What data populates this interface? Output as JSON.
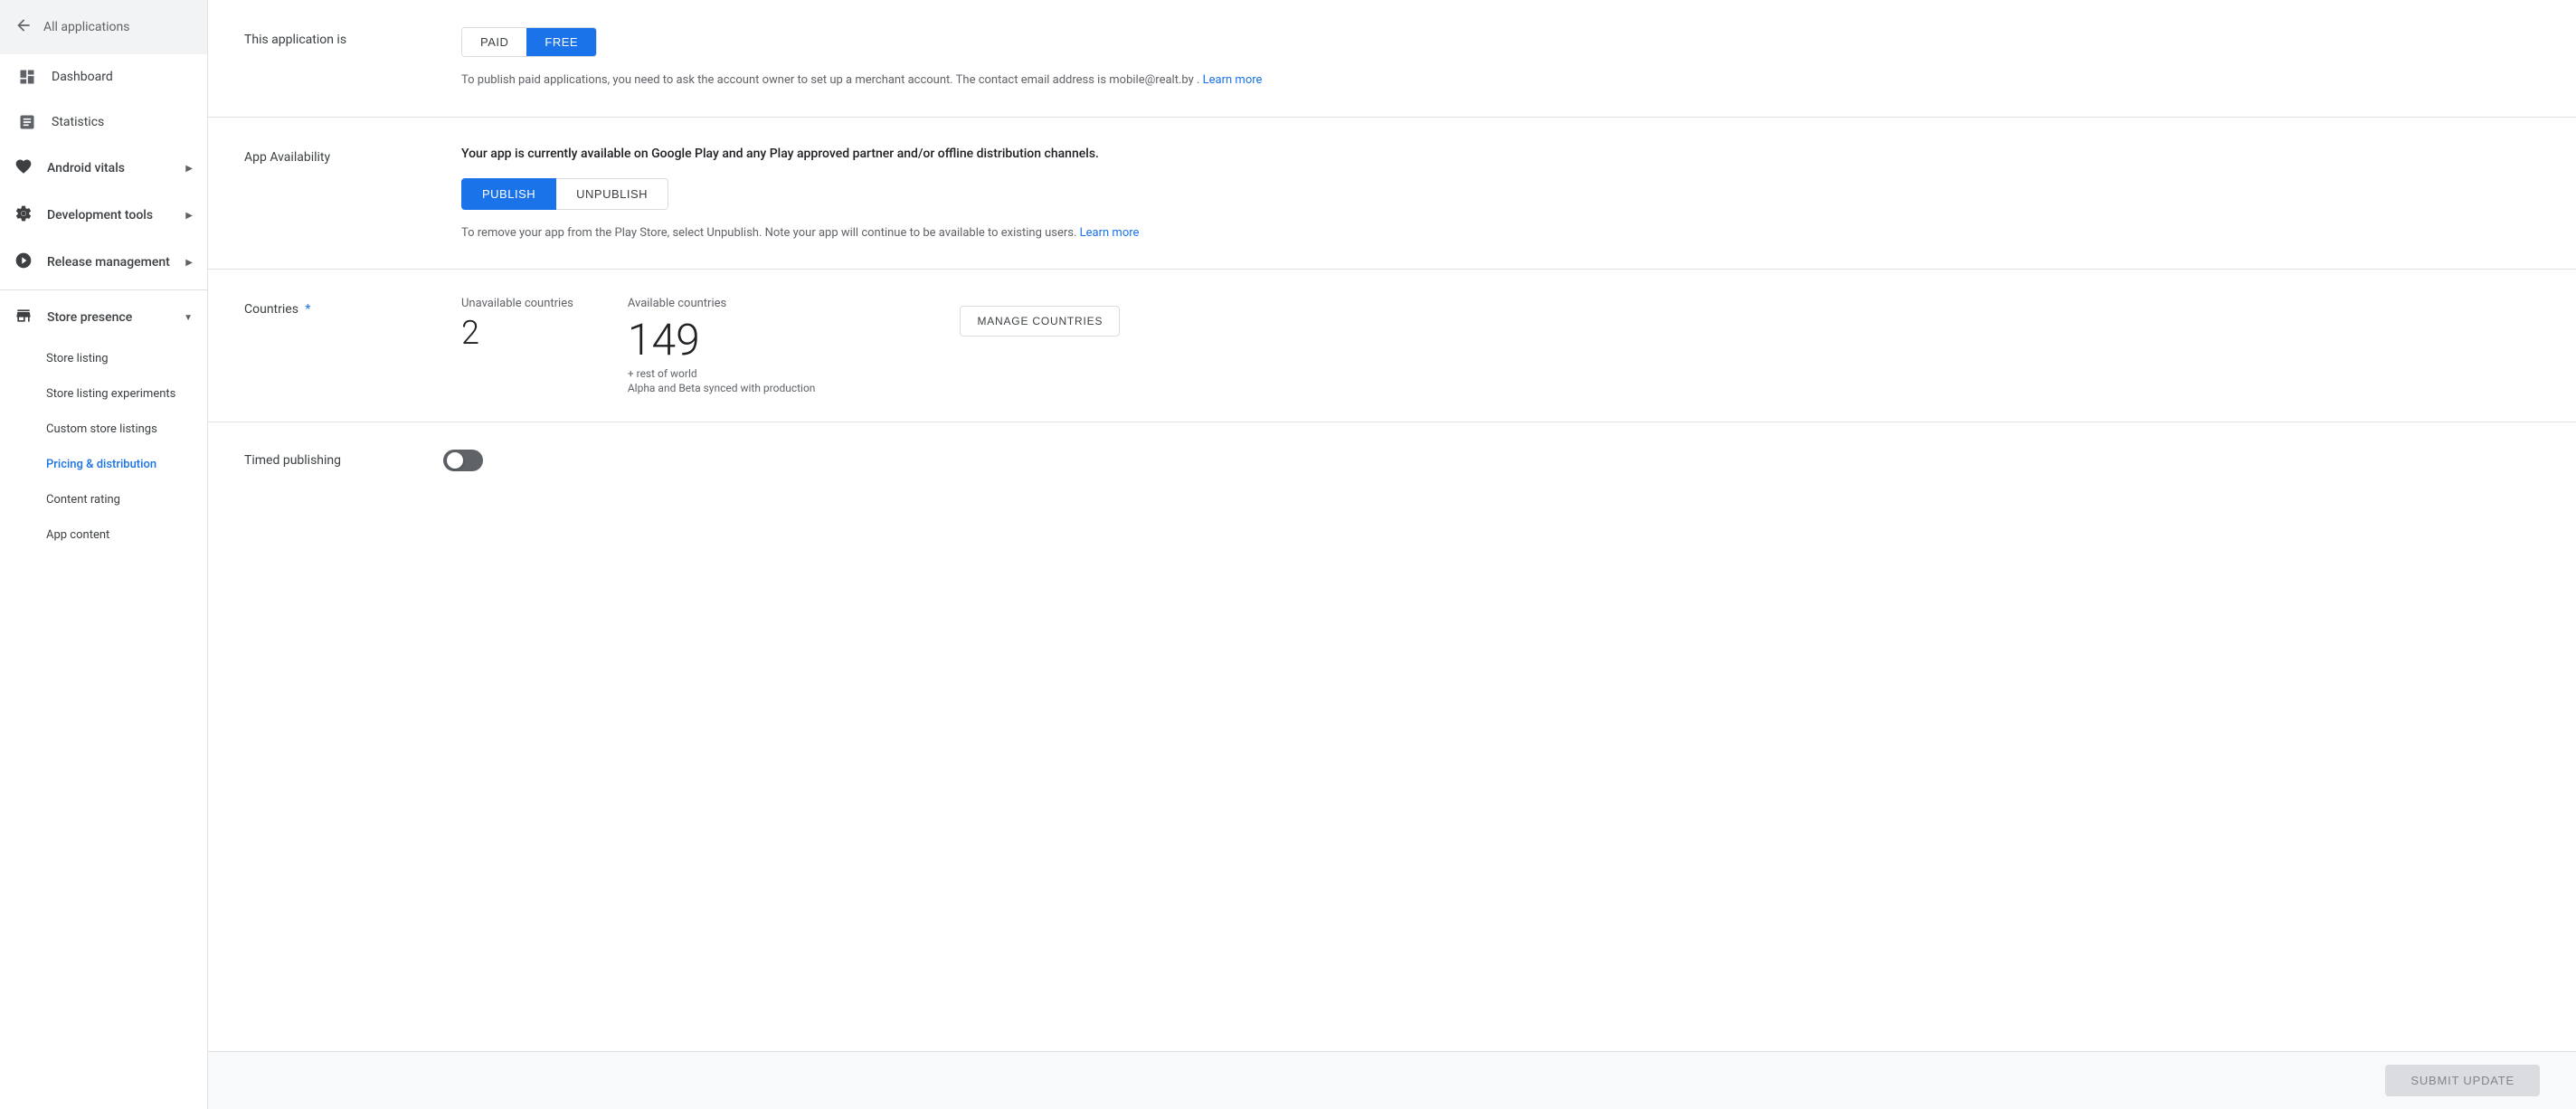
{
  "sidebar": {
    "back_label": "All applications",
    "items": [
      {
        "id": "dashboard",
        "label": "Dashboard",
        "icon": "dashboard"
      },
      {
        "id": "statistics",
        "label": "Statistics",
        "icon": "bar-chart"
      },
      {
        "id": "android-vitals",
        "label": "Android vitals",
        "icon": "vitals",
        "has_children": true
      },
      {
        "id": "development-tools",
        "label": "Development tools",
        "icon": "dev-tools",
        "has_children": true
      },
      {
        "id": "release-management",
        "label": "Release management",
        "icon": "release",
        "has_children": true
      },
      {
        "id": "store-presence",
        "label": "Store presence",
        "icon": "store",
        "expanded": true
      }
    ],
    "sub_items": [
      {
        "id": "store-listing",
        "label": "Store listing"
      },
      {
        "id": "store-listing-experiments",
        "label": "Store listing experiments"
      },
      {
        "id": "custom-store-listings",
        "label": "Custom store listings"
      },
      {
        "id": "pricing-distribution",
        "label": "Pricing & distribution",
        "active": true
      },
      {
        "id": "content-rating",
        "label": "Content rating"
      },
      {
        "id": "app-content",
        "label": "App content"
      }
    ]
  },
  "page": {
    "paid_label": "PAID",
    "free_label": "FREE",
    "this_application_is_label": "This application is",
    "paid_info_text": "To publish paid applications, you need to ask the account owner to set up a merchant account. The contact email address is mobile@realt.by .",
    "learn_more_1": "Learn more",
    "app_availability_label": "App Availability",
    "availability_description": "Your app is currently available on Google Play and any Play approved partner and/or offline distribution channels.",
    "publish_label": "PUBLISH",
    "unpublish_label": "UNPUBLISH",
    "unpublish_info": "To remove your app from the Play Store, select Unpublish. Note your app will continue to be available to existing users.",
    "learn_more_2": "Learn more",
    "countries_label": "Countries",
    "unavailable_label": "Unavailable countries",
    "unavailable_count": "2",
    "available_label": "Available countries",
    "available_count": "149",
    "rest_of_world": "+ rest of world",
    "sync_note": "Alpha and Beta synced with production",
    "manage_countries_label": "MANAGE COUNTRIES",
    "timed_publishing_label": "Timed publishing",
    "submit_update_label": "SUBMIT UPDATE"
  }
}
